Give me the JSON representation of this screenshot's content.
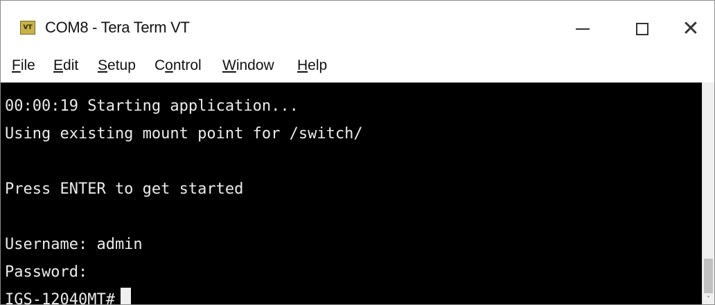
{
  "window": {
    "title": "COM8 - Tera Term VT",
    "icon_name": "teraterm-vt-icon",
    "icon_text": "VT",
    "controls": {
      "minimize_icon": "minimize-icon",
      "maximize_icon": "maximize-icon",
      "close_icon": "close-icon",
      "close_glyph": "✕"
    }
  },
  "menu": {
    "items": [
      {
        "accel": "F",
        "rest": "ile"
      },
      {
        "accel": "E",
        "rest": "dit"
      },
      {
        "accel": "S",
        "rest": "etup"
      },
      {
        "pre": "C",
        "accel": "o",
        "rest": "ntrol"
      },
      {
        "accel": "W",
        "rest": "indow"
      },
      {
        "accel": "H",
        "rest": "elp"
      }
    ]
  },
  "terminal": {
    "lines": [
      "00:00:19 Starting application...",
      "Using existing mount point for /switch/",
      "",
      "Press ENTER to get started",
      "",
      "Username: admin",
      "Password:",
      "IGS-12040MT#"
    ],
    "background": "#000000",
    "foreground": "#ececec"
  },
  "scrollbar": {
    "down_arrow": "˅"
  }
}
